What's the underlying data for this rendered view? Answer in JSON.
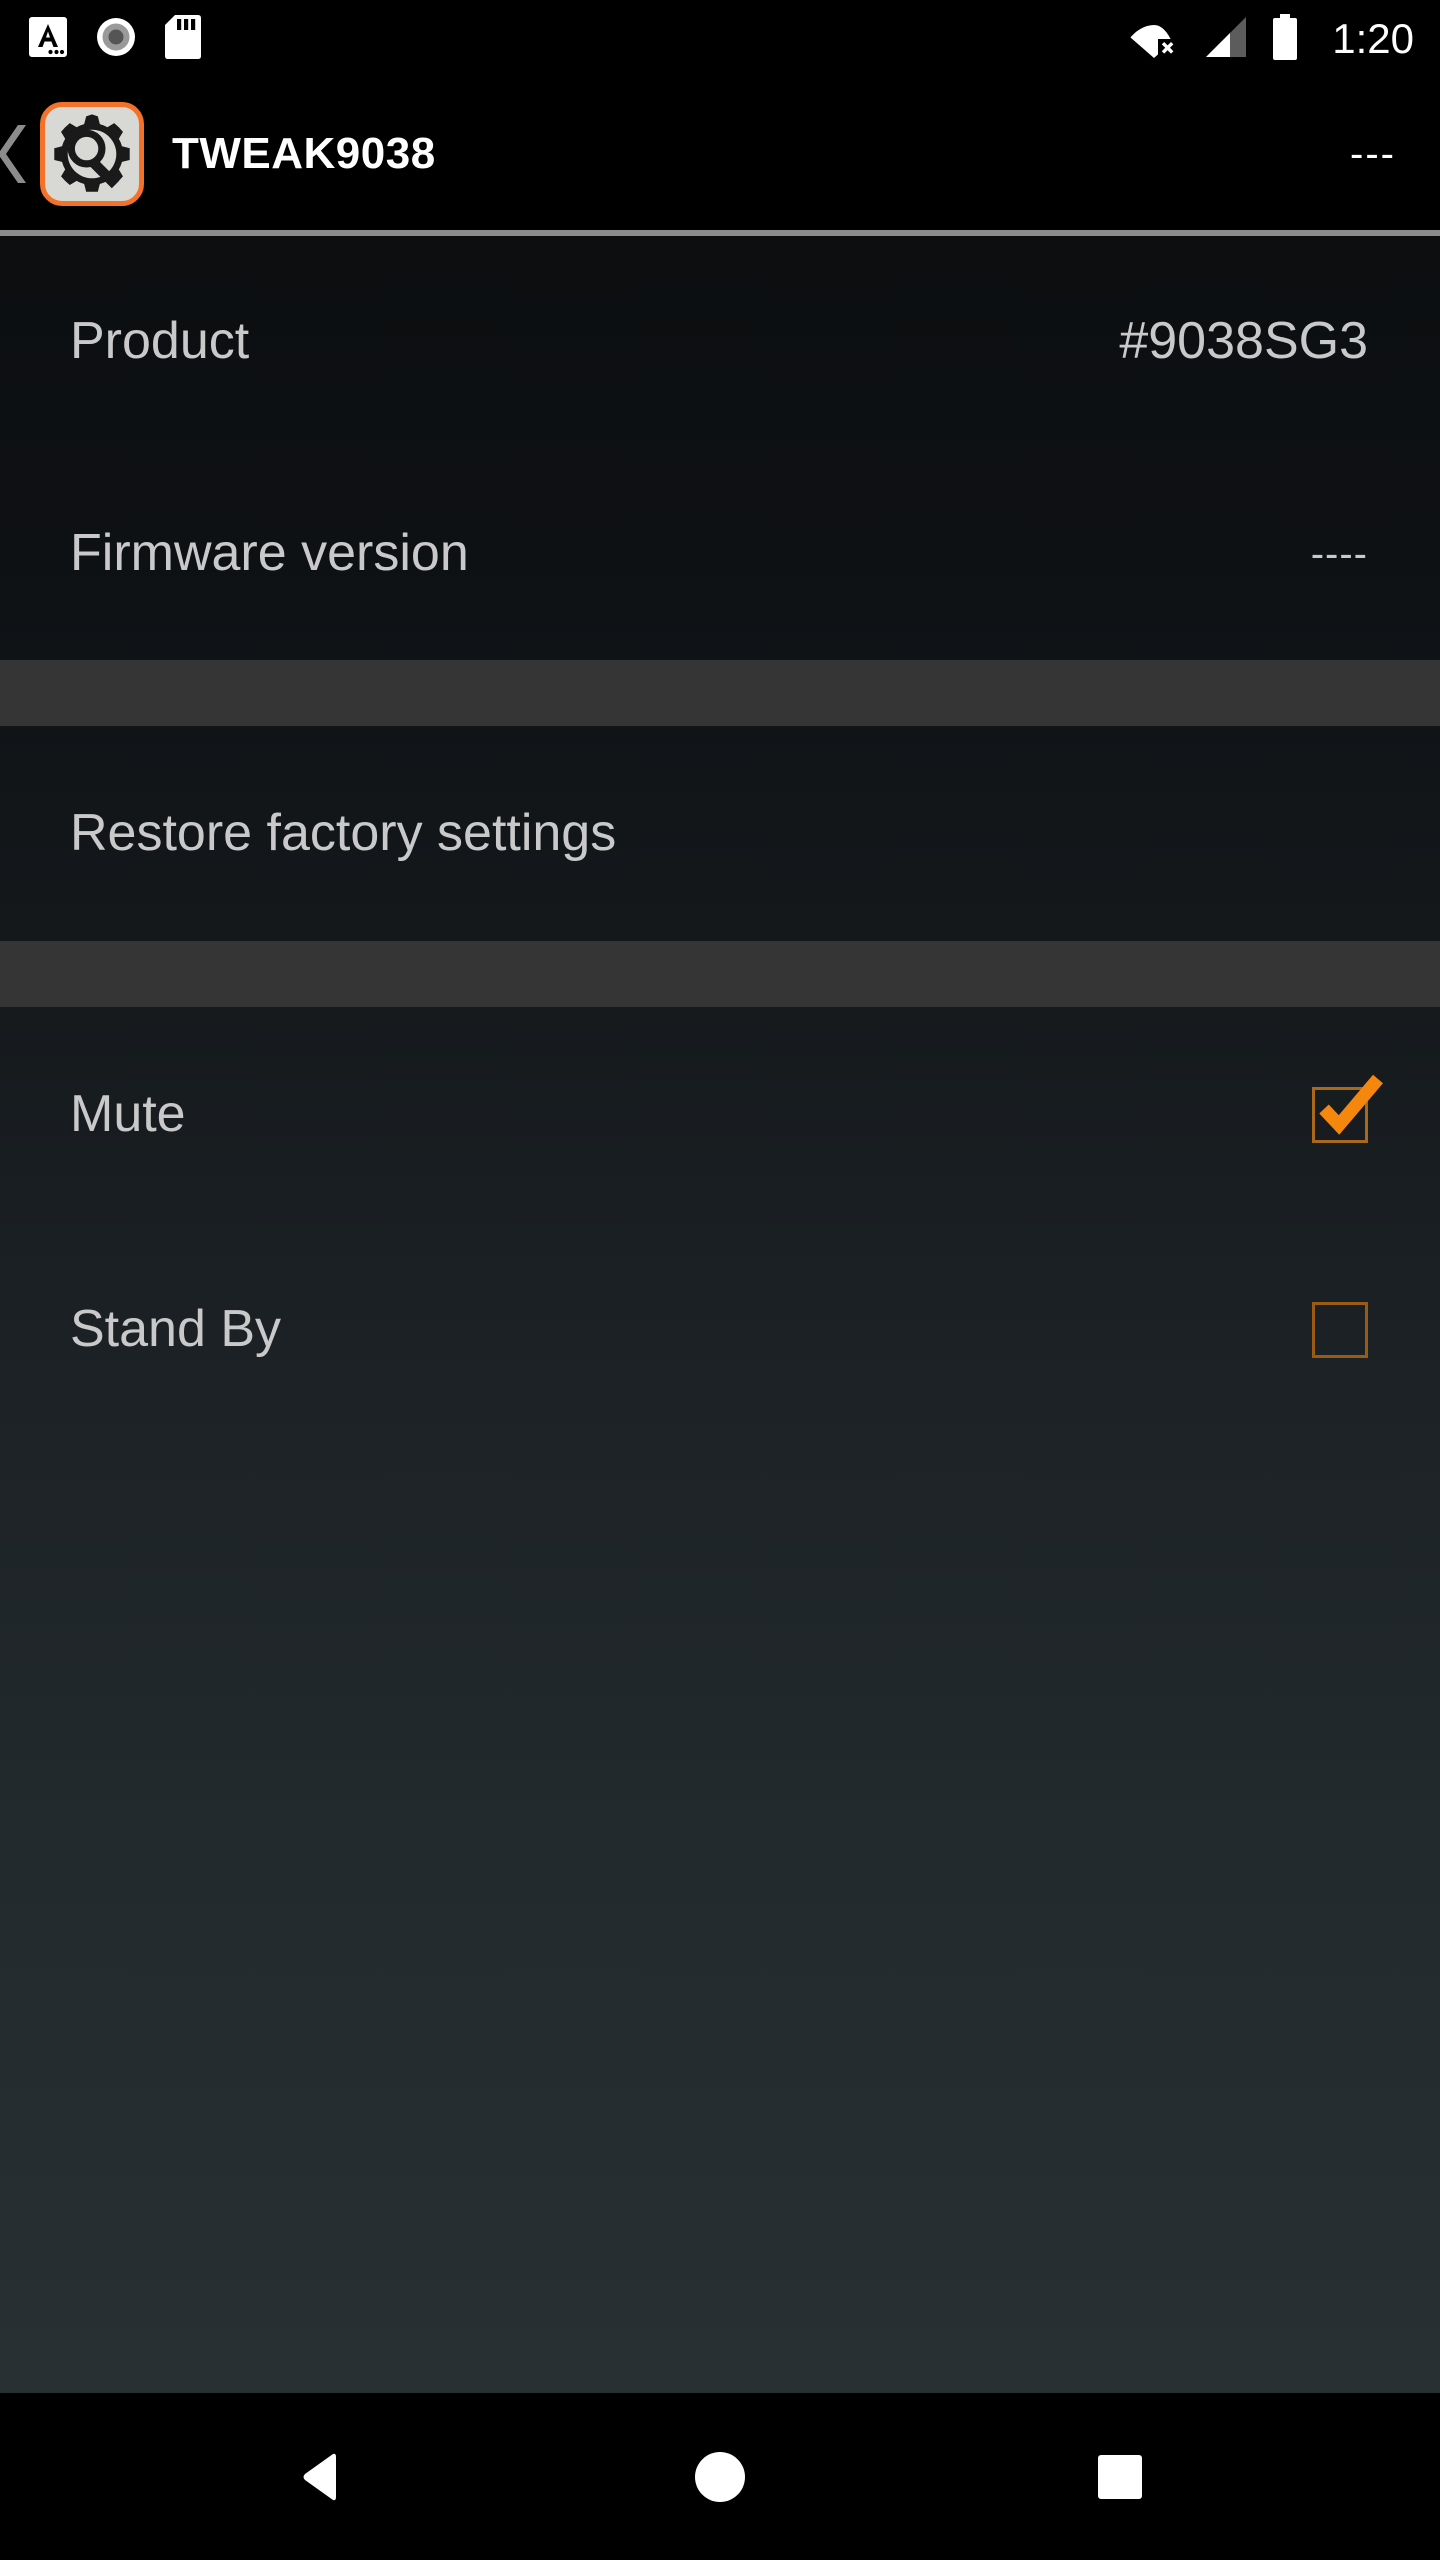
{
  "status_bar": {
    "notification_icons": [
      "text-a-icon",
      "record-circle-icon",
      "sd-card-icon"
    ],
    "connectivity_icons": [
      "wifi-off-icon",
      "cellular-signal-icon",
      "battery-full-icon"
    ],
    "clock": "1:20"
  },
  "app_bar": {
    "back_label": "❮",
    "app_icon": "gear-wrench-icon",
    "title": "TWEAK9038",
    "action_label": "---",
    "icon_border_color": "#f4712a"
  },
  "content": {
    "rows": [
      {
        "title": "Product",
        "value": "#9038SG3",
        "type": "info"
      },
      {
        "title": "Firmware version",
        "value": "----",
        "type": "info"
      },
      {
        "title": "Restore factory settings",
        "value": "",
        "type": "action"
      },
      {
        "title": "Mute",
        "value": "",
        "type": "checkbox",
        "checked": true
      },
      {
        "title": "Stand By",
        "value": "",
        "type": "checkbox",
        "checked": false
      }
    ],
    "accent_color": "#f5870f",
    "checkbox_border_color": "#9a5a16",
    "separator_color": "#353535",
    "text_color": "#c9c9c9"
  },
  "nav_bar": {
    "back": "back-triangle-icon",
    "home": "home-circle-icon",
    "recents": "recents-square-icon"
  }
}
